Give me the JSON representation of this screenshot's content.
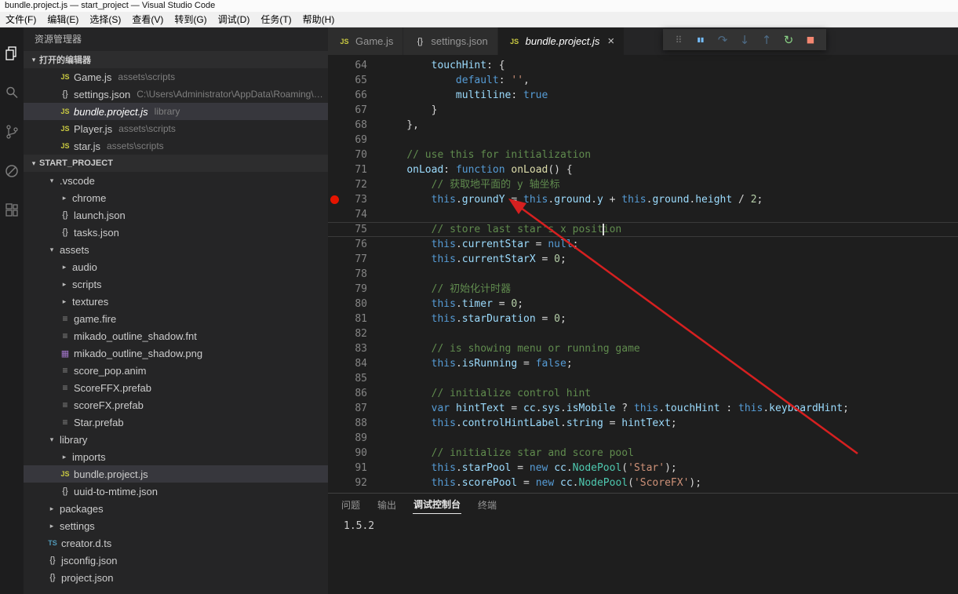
{
  "window": {
    "title": "bundle.project.js — start_project — Visual Studio Code",
    "menus": [
      {
        "label": "文件(F)"
      },
      {
        "label": "编辑(E)"
      },
      {
        "label": "选择(S)"
      },
      {
        "label": "查看(V)"
      },
      {
        "label": "转到(G)"
      },
      {
        "label": "调试(D)"
      },
      {
        "label": "任务(T)"
      },
      {
        "label": "帮助(H)"
      }
    ]
  },
  "activity_bar": {
    "icons": [
      {
        "name": "explorer",
        "active": true
      },
      {
        "name": "search"
      },
      {
        "name": "source-control"
      },
      {
        "name": "debug"
      },
      {
        "name": "extensions"
      }
    ]
  },
  "sidebar": {
    "title": "资源管理器",
    "open_editors": {
      "header": "打开的编辑器",
      "items": [
        {
          "icon": "js",
          "name": "Game.js",
          "detail": "assets\\scripts"
        },
        {
          "icon": "json",
          "name": "settings.json",
          "detail": "C:\\Users\\Administrator\\AppData\\Roaming\\Co..."
        },
        {
          "icon": "js",
          "name": "bundle.project.js",
          "detail": "library",
          "active": true,
          "italic": true
        },
        {
          "icon": "js",
          "name": "Player.js",
          "detail": "assets\\scripts"
        },
        {
          "icon": "js",
          "name": "star.js",
          "detail": "assets\\scripts"
        }
      ]
    },
    "project": {
      "header": "START_PROJECT",
      "items": [
        {
          "indent": 0,
          "kind": "folder",
          "state": "expanded",
          "name": ".vscode"
        },
        {
          "indent": 1,
          "kind": "folder",
          "state": "collapsed",
          "name": "chrome"
        },
        {
          "indent": 1,
          "kind": "file",
          "icon": "json",
          "name": "launch.json"
        },
        {
          "indent": 1,
          "kind": "file",
          "icon": "json",
          "name": "tasks.json"
        },
        {
          "indent": 0,
          "kind": "folder",
          "state": "expanded",
          "name": "assets"
        },
        {
          "indent": 1,
          "kind": "folder",
          "state": "collapsed",
          "name": "audio"
        },
        {
          "indent": 1,
          "kind": "folder",
          "state": "collapsed",
          "name": "scripts"
        },
        {
          "indent": 1,
          "kind": "folder",
          "state": "collapsed",
          "name": "textures"
        },
        {
          "indent": 1,
          "kind": "file",
          "icon": "file",
          "name": "game.fire"
        },
        {
          "indent": 1,
          "kind": "file",
          "icon": "file",
          "name": "mikado_outline_shadow.fnt"
        },
        {
          "indent": 1,
          "kind": "file",
          "icon": "image",
          "name": "mikado_outline_shadow.png"
        },
        {
          "indent": 1,
          "kind": "file",
          "icon": "file",
          "name": "score_pop.anim"
        },
        {
          "indent": 1,
          "kind": "file",
          "icon": "file",
          "name": "ScoreFFX.prefab"
        },
        {
          "indent": 1,
          "kind": "file",
          "icon": "file",
          "name": "scoreFX.prefab"
        },
        {
          "indent": 1,
          "kind": "file",
          "icon": "file",
          "name": "Star.prefab"
        },
        {
          "indent": 0,
          "kind": "folder",
          "state": "expanded",
          "name": "library"
        },
        {
          "indent": 1,
          "kind": "folder",
          "state": "collapsed",
          "name": "imports"
        },
        {
          "indent": 1,
          "kind": "file",
          "icon": "js",
          "name": "bundle.project.js",
          "selected": true
        },
        {
          "indent": 1,
          "kind": "file",
          "icon": "json",
          "name": "uuid-to-mtime.json"
        },
        {
          "indent": 0,
          "kind": "folder",
          "state": "collapsed",
          "name": "packages"
        },
        {
          "indent": 0,
          "kind": "folder",
          "state": "collapsed",
          "name": "settings"
        },
        {
          "indent": 0,
          "kind": "file",
          "icon": "ts",
          "name": "creator.d.ts"
        },
        {
          "indent": 0,
          "kind": "file",
          "icon": "json",
          "name": "jsconfig.json"
        },
        {
          "indent": 0,
          "kind": "file",
          "icon": "json",
          "name": "project.json"
        }
      ]
    }
  },
  "editor": {
    "tabs": [
      {
        "icon": "js",
        "label": "Game.js"
      },
      {
        "icon": "json",
        "label": "settings.json"
      },
      {
        "icon": "js",
        "label": "bundle.project.js",
        "active": true,
        "italic": true,
        "close": "×"
      }
    ],
    "debug_toolbar": [
      {
        "name": "drag-handle",
        "enabled": true
      },
      {
        "name": "pause",
        "enabled": true
      },
      {
        "name": "step-over",
        "enabled": false
      },
      {
        "name": "step-into",
        "enabled": false
      },
      {
        "name": "step-out",
        "enabled": false
      },
      {
        "name": "restart",
        "enabled": true
      },
      {
        "name": "stop",
        "enabled": true
      }
    ],
    "lines": [
      {
        "num": 64,
        "tokens": [
          [
            "pl",
            "        "
          ],
          [
            "prop",
            "touchHint"
          ],
          [
            "pl",
            ": {"
          ]
        ]
      },
      {
        "num": 65,
        "tokens": [
          [
            "pl",
            "            "
          ],
          [
            "kw",
            "default"
          ],
          [
            "pl",
            ": "
          ],
          [
            "str",
            "''"
          ],
          [
            "pl",
            ","
          ]
        ]
      },
      {
        "num": 66,
        "tokens": [
          [
            "pl",
            "            "
          ],
          [
            "prop",
            "multiline"
          ],
          [
            "pl",
            ": "
          ],
          [
            "kw",
            "true"
          ]
        ]
      },
      {
        "num": 67,
        "tokens": [
          [
            "pl",
            "        }"
          ]
        ]
      },
      {
        "num": 68,
        "tokens": [
          [
            "pl",
            "    },"
          ]
        ]
      },
      {
        "num": 69,
        "tokens": []
      },
      {
        "num": 70,
        "tokens": [
          [
            "pl",
            "    "
          ],
          [
            "cm",
            "// use this for initialization"
          ]
        ]
      },
      {
        "num": 71,
        "tokens": [
          [
            "pl",
            "    "
          ],
          [
            "prop",
            "onLoad"
          ],
          [
            "pl",
            ": "
          ],
          [
            "kw",
            "function"
          ],
          [
            "pl",
            " "
          ],
          [
            "fn",
            "onLoad"
          ],
          [
            "pl",
            "() {"
          ]
        ]
      },
      {
        "num": 72,
        "tokens": [
          [
            "pl",
            "        "
          ],
          [
            "cm",
            "// 获取地平面的 y 轴坐标"
          ]
        ]
      },
      {
        "num": 73,
        "breakpoint": true,
        "tokens": [
          [
            "pl",
            "        "
          ],
          [
            "kw",
            "this"
          ],
          [
            "pl",
            "."
          ],
          [
            "prop",
            "groundY"
          ],
          [
            "pl",
            " = "
          ],
          [
            "kw",
            "this"
          ],
          [
            "pl",
            "."
          ],
          [
            "prop",
            "ground"
          ],
          [
            "pl",
            "."
          ],
          [
            "prop",
            "y"
          ],
          [
            "pl",
            " + "
          ],
          [
            "kw",
            "this"
          ],
          [
            "pl",
            "."
          ],
          [
            "prop",
            "ground"
          ],
          [
            "pl",
            "."
          ],
          [
            "prop",
            "height"
          ],
          [
            "pl",
            " / "
          ],
          [
            "num",
            "2"
          ],
          [
            "pl",
            ";"
          ]
        ]
      },
      {
        "num": 74,
        "tokens": []
      },
      {
        "num": 75,
        "current": true,
        "tokens": [
          [
            "pl",
            "        "
          ],
          [
            "cm",
            "// store last star's x posit"
          ],
          [
            "caret",
            ""
          ],
          [
            "cm",
            "ion"
          ]
        ]
      },
      {
        "num": 76,
        "tokens": [
          [
            "pl",
            "        "
          ],
          [
            "kw",
            "this"
          ],
          [
            "pl",
            "."
          ],
          [
            "prop",
            "currentStar"
          ],
          [
            "pl",
            " = "
          ],
          [
            "kw",
            "null"
          ],
          [
            "pl",
            ";"
          ]
        ]
      },
      {
        "num": 77,
        "tokens": [
          [
            "pl",
            "        "
          ],
          [
            "kw",
            "this"
          ],
          [
            "pl",
            "."
          ],
          [
            "prop",
            "currentStarX"
          ],
          [
            "pl",
            " = "
          ],
          [
            "num",
            "0"
          ],
          [
            "pl",
            ";"
          ]
        ]
      },
      {
        "num": 78,
        "tokens": []
      },
      {
        "num": 79,
        "tokens": [
          [
            "pl",
            "        "
          ],
          [
            "cm",
            "// 初始化计时器"
          ]
        ]
      },
      {
        "num": 80,
        "tokens": [
          [
            "pl",
            "        "
          ],
          [
            "kw",
            "this"
          ],
          [
            "pl",
            "."
          ],
          [
            "prop",
            "timer"
          ],
          [
            "pl",
            " = "
          ],
          [
            "num",
            "0"
          ],
          [
            "pl",
            ";"
          ]
        ]
      },
      {
        "num": 81,
        "tokens": [
          [
            "pl",
            "        "
          ],
          [
            "kw",
            "this"
          ],
          [
            "pl",
            "."
          ],
          [
            "prop",
            "starDuration"
          ],
          [
            "pl",
            " = "
          ],
          [
            "num",
            "0"
          ],
          [
            "pl",
            ";"
          ]
        ]
      },
      {
        "num": 82,
        "tokens": []
      },
      {
        "num": 83,
        "tokens": [
          [
            "pl",
            "        "
          ],
          [
            "cm",
            "// is showing menu or running game"
          ]
        ]
      },
      {
        "num": 84,
        "tokens": [
          [
            "pl",
            "        "
          ],
          [
            "kw",
            "this"
          ],
          [
            "pl",
            "."
          ],
          [
            "prop",
            "isRunning"
          ],
          [
            "pl",
            " = "
          ],
          [
            "kw",
            "false"
          ],
          [
            "pl",
            ";"
          ]
        ]
      },
      {
        "num": 85,
        "tokens": []
      },
      {
        "num": 86,
        "tokens": [
          [
            "pl",
            "        "
          ],
          [
            "cm",
            "// initialize control hint"
          ]
        ]
      },
      {
        "num": 87,
        "tokens": [
          [
            "pl",
            "        "
          ],
          [
            "kw",
            "var"
          ],
          [
            "pl",
            " "
          ],
          [
            "prop",
            "hintText"
          ],
          [
            "pl",
            " = "
          ],
          [
            "prop",
            "cc"
          ],
          [
            "pl",
            "."
          ],
          [
            "prop",
            "sys"
          ],
          [
            "pl",
            "."
          ],
          [
            "prop",
            "isMobile"
          ],
          [
            "pl",
            " ? "
          ],
          [
            "kw",
            "this"
          ],
          [
            "pl",
            "."
          ],
          [
            "prop",
            "touchHint"
          ],
          [
            "pl",
            " : "
          ],
          [
            "kw",
            "this"
          ],
          [
            "pl",
            "."
          ],
          [
            "prop",
            "keyboardHint"
          ],
          [
            "pl",
            ";"
          ]
        ]
      },
      {
        "num": 88,
        "tokens": [
          [
            "pl",
            "        "
          ],
          [
            "kw",
            "this"
          ],
          [
            "pl",
            "."
          ],
          [
            "prop",
            "controlHintLabel"
          ],
          [
            "pl",
            "."
          ],
          [
            "prop",
            "string"
          ],
          [
            "pl",
            " = "
          ],
          [
            "prop",
            "hintText"
          ],
          [
            "pl",
            ";"
          ]
        ]
      },
      {
        "num": 89,
        "tokens": []
      },
      {
        "num": 90,
        "tokens": [
          [
            "pl",
            "        "
          ],
          [
            "cm",
            "// initialize star and score pool"
          ]
        ]
      },
      {
        "num": 91,
        "tokens": [
          [
            "pl",
            "        "
          ],
          [
            "kw",
            "this"
          ],
          [
            "pl",
            "."
          ],
          [
            "prop",
            "starPool"
          ],
          [
            "pl",
            " = "
          ],
          [
            "kw",
            "new"
          ],
          [
            "pl",
            " "
          ],
          [
            "prop",
            "cc"
          ],
          [
            "pl",
            "."
          ],
          [
            "cls",
            "NodePool"
          ],
          [
            "pl",
            "("
          ],
          [
            "str",
            "'Star'"
          ],
          [
            "pl",
            ");"
          ]
        ]
      },
      {
        "num": 92,
        "tokens": [
          [
            "pl",
            "        "
          ],
          [
            "kw",
            "this"
          ],
          [
            "pl",
            "."
          ],
          [
            "prop",
            "scorePool"
          ],
          [
            "pl",
            " = "
          ],
          [
            "kw",
            "new"
          ],
          [
            "pl",
            " "
          ],
          [
            "prop",
            "cc"
          ],
          [
            "pl",
            "."
          ],
          [
            "cls",
            "NodePool"
          ],
          [
            "pl",
            "("
          ],
          [
            "str",
            "'ScoreFX'"
          ],
          [
            "pl",
            ");"
          ]
        ]
      }
    ]
  },
  "panel": {
    "tabs": [
      {
        "label": "问题"
      },
      {
        "label": "输出"
      },
      {
        "label": "调试控制台",
        "active": true
      },
      {
        "label": "终端"
      }
    ],
    "content": "1.5.2"
  },
  "annotation": {
    "color": "#d62020"
  }
}
